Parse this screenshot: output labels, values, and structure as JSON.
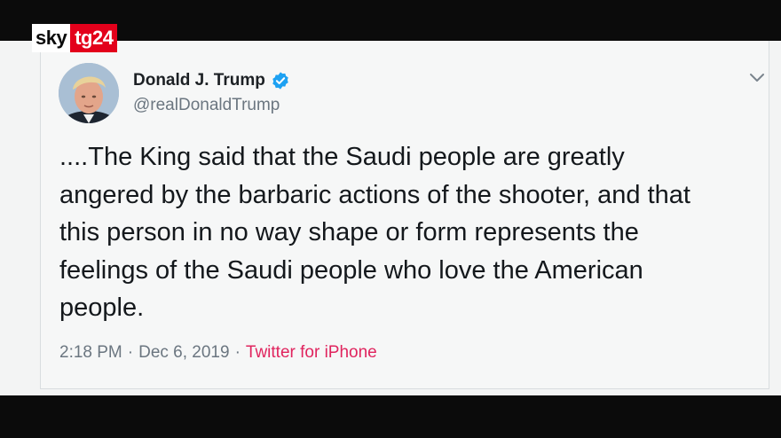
{
  "broadcaster": {
    "logo_left": "sky",
    "logo_right": "tg24"
  },
  "tweet": {
    "author_name": "Donald J. Trump",
    "handle": "@realDonaldTrump",
    "text": "....The King said that the Saudi people are greatly\nangered by the barbaric actions of the shooter, and that\nthis person in no way shape or form represents the\nfeelings of the Saudi people who love the American\npeople.",
    "time": "2:18 PM",
    "separator": "·",
    "date": "Dec 6, 2019",
    "source": "Twitter for iPhone"
  },
  "icons": {
    "verified": "verified-badge-icon",
    "menu": "chevron-down-icon"
  },
  "colors": {
    "verified_blue": "#1da1f2",
    "source_pink": "#e0245e",
    "tg24_red": "#e3001b"
  }
}
